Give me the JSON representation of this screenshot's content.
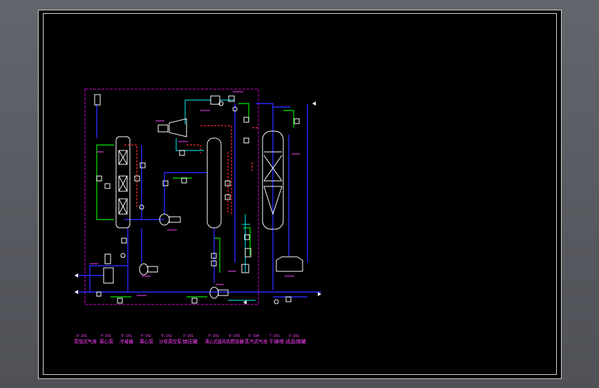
{
  "equipment": [
    {
      "id": "eq-d101",
      "tag": "D-101",
      "name": "蒸馏式气液"
    },
    {
      "id": "eq-f101",
      "tag": "F-101",
      "name": "离心泵"
    },
    {
      "id": "eq-e101",
      "tag": "E-101",
      "name": "冷凝器"
    },
    {
      "id": "eq-f102",
      "tag": "F-102",
      "name": "离心泵"
    },
    {
      "id": "eq-e102",
      "tag": "E-102",
      "name": "沙浆真空泵"
    },
    {
      "id": "eq-v101",
      "tag": "V-101",
      "name": "储压罐"
    },
    {
      "id": "eq-p101",
      "tag": "P-101",
      "name": "离心式鼓风机"
    },
    {
      "id": "eq-e103",
      "tag": "E-103",
      "name": "燃烧器"
    },
    {
      "id": "eq-e104",
      "tag": "E-104",
      "name": "蒸汽式气液"
    },
    {
      "id": "eq-t101",
      "tag": "T-101",
      "name": "干燥塔"
    },
    {
      "id": "eq-v102",
      "tag": "V-102",
      "name": "成品储罐"
    }
  ],
  "colors": {
    "background": "#000000",
    "process_line": "#2a2aff",
    "steam_line": "#00c800",
    "return_line": "#ff2a2a",
    "air_line": "#00d0d0",
    "boundary": "#d000d0",
    "equipment": "#ffffff",
    "tag": "#ff40ff"
  }
}
